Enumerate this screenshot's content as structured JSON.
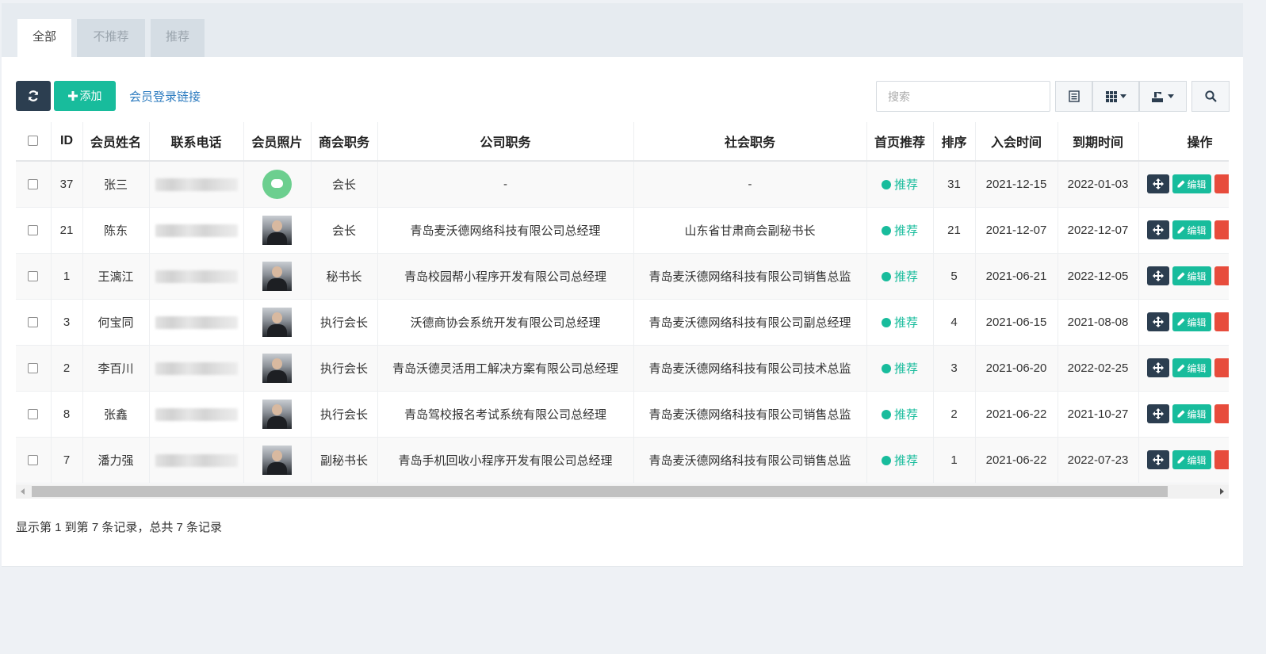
{
  "tabs": [
    "全部",
    "不推荐",
    "推荐"
  ],
  "toolbar": {
    "add_label": "添加",
    "login_link": "会员登录链接",
    "search_placeholder": "搜索"
  },
  "columns": [
    "ID",
    "会员姓名",
    "联系电话",
    "会员照片",
    "商会职务",
    "公司职务",
    "社会职务",
    "首页推荐",
    "排序",
    "入会时间",
    "到期时间",
    "操作"
  ],
  "rows": [
    {
      "id": "37",
      "name": "张三",
      "photo": "avatar-icon",
      "chamber_role": "会长",
      "company_role": "-",
      "social_role": "-",
      "recommend": "推荐",
      "sort": "31",
      "join_date": "2021-12-15",
      "expire_date": "2022-01-03"
    },
    {
      "id": "21",
      "name": "陈东",
      "photo": "photo",
      "chamber_role": "会长",
      "company_role": "青岛麦沃德网络科技有限公司总经理",
      "social_role": "山东省甘肃商会副秘书长",
      "recommend": "推荐",
      "sort": "21",
      "join_date": "2021-12-07",
      "expire_date": "2022-12-07"
    },
    {
      "id": "1",
      "name": "王漓江",
      "photo": "photo",
      "chamber_role": "秘书长",
      "company_role": "青岛校园帮小程序开发有限公司总经理",
      "social_role": "青岛麦沃德网络科技有限公司销售总监",
      "recommend": "推荐",
      "sort": "5",
      "join_date": "2021-06-21",
      "expire_date": "2022-12-05"
    },
    {
      "id": "3",
      "name": "何宝同",
      "photo": "photo",
      "chamber_role": "执行会长",
      "company_role": "沃德商协会系统开发有限公司总经理",
      "social_role": "青岛麦沃德网络科技有限公司副总经理",
      "recommend": "推荐",
      "sort": "4",
      "join_date": "2021-06-15",
      "expire_date": "2021-08-08"
    },
    {
      "id": "2",
      "name": "李百川",
      "photo": "photo",
      "chamber_role": "执行会长",
      "company_role": "青岛沃德灵活用工解决方案有限公司总经理",
      "social_role": "青岛麦沃德网络科技有限公司技术总监",
      "recommend": "推荐",
      "sort": "3",
      "join_date": "2021-06-20",
      "expire_date": "2022-02-25"
    },
    {
      "id": "8",
      "name": "张鑫",
      "photo": "photo",
      "chamber_role": "执行会长",
      "company_role": "青岛驾校报名考试系统有限公司总经理",
      "social_role": "青岛麦沃德网络科技有限公司销售总监",
      "recommend": "推荐",
      "sort": "2",
      "join_date": "2021-06-22",
      "expire_date": "2021-10-27"
    },
    {
      "id": "7",
      "name": "潘力强",
      "photo": "photo",
      "chamber_role": "副秘书长",
      "company_role": "青岛手机回收小程序开发有限公司总经理",
      "social_role": "青岛麦沃德网络科技有限公司销售总监",
      "recommend": "推荐",
      "sort": "1",
      "join_date": "2021-06-22",
      "expire_date": "2022-07-23"
    }
  ],
  "edit_label": "编辑",
  "summary": "显示第 1 到第 7 条记录，总共 7 条记录",
  "colors": {
    "accent": "#18bc9c",
    "dark": "#2c3e50",
    "link": "#2c7bbf",
    "danger": "#e74c3c"
  }
}
